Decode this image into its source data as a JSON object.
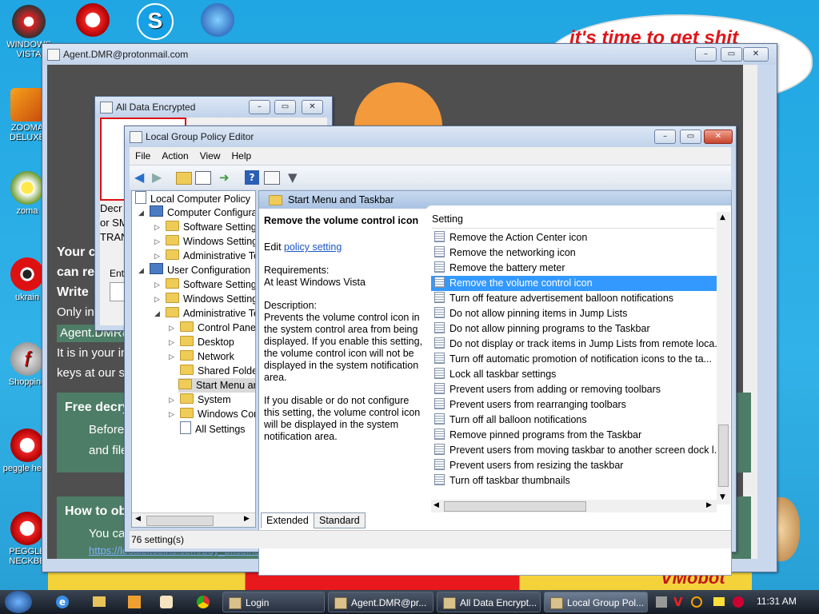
{
  "desktop": {
    "icons": [
      {
        "label": "WINDOWS VISTA",
        "icon": "vista-icon"
      },
      {
        "label": "ZOOMA DELUXE",
        "icon": "zooma-icon"
      },
      {
        "label": "zoma",
        "icon": "flower-icon"
      },
      {
        "label": "ukrain",
        "icon": "radiation-icon"
      },
      {
        "label": "Shopping",
        "icon": "flash-icon"
      },
      {
        "label": "peggle hegg",
        "icon": "peggle-icon"
      },
      {
        "label": "PEGGLE NECKBE",
        "icon": "peggle-icon"
      }
    ],
    "bubble_text": "it's time to get shit",
    "vmobot": "VMobot"
  },
  "ransom_window": {
    "title": "Agent.DMR@protonmail.com",
    "lines": {
      "your_line": "Your c",
      "can_line": "can re",
      "write_line": "Write",
      "only_line": "Only in",
      "agent_line": "Agent.DMR@",
      "it_line": "It is in your in",
      "keys_line": "keys at our s",
      "free_title": "Free decry",
      "before_line": "Before",
      "and_line": "and file",
      "how_title": "How to obt",
      "you_line": "You ca",
      "link": "https://localbitcoins.com/buy_bitcoins"
    }
  },
  "encrypted_window": {
    "title": "All Data Encrypted",
    "lines": {
      "l1": "Decr",
      "l2": "or SM",
      "l3": "TRAN",
      "enter": "Ente"
    }
  },
  "gpedit": {
    "title": "Local Group Policy Editor",
    "menu": [
      "File",
      "Action",
      "View",
      "Help"
    ],
    "toolbar_icons": [
      "back-arrow-icon",
      "forward-arrow-icon",
      "up-folder-icon",
      "show-hide-tree-icon",
      "export-list-icon",
      "help-icon",
      "properties-icon",
      "filter-icon"
    ],
    "tree": {
      "root": "Local Computer Policy",
      "computer_config": "Computer Configura",
      "cc_software": "Software Settings",
      "cc_windows": "Windows Setting",
      "cc_admin": "Administrative Te",
      "user_config": "User Configuration",
      "uc_software": "Software Settings",
      "uc_windows": "Windows Settings",
      "uc_admin": "Administrative Te",
      "control_panel": "Control Panel",
      "desktop": "Desktop",
      "network": "Network",
      "shared_folders": "Shared Folder",
      "start_menu": "Start Menu ar",
      "system": "System",
      "windows_comp": "Windows Cor",
      "all_settings": "All Settings"
    },
    "header": "Start Menu and Taskbar",
    "detail": {
      "title": "Remove the volume control icon",
      "edit_prefix": "Edit",
      "edit_link": "policy setting",
      "req_label": "Requirements:",
      "req_value": "At least Windows Vista",
      "desc_label": "Description:",
      "desc_p1": "Prevents the volume control icon in the system control area from being displayed. If you enable this setting, the volume control icon will not be displayed in the system notification area.",
      "desc_p2": "If you disable or do not configure this setting, the volume control icon will be displayed in the system notification area."
    },
    "column_header": "Setting",
    "settings": [
      "Remove the Action Center icon",
      "Remove the networking icon",
      "Remove the battery meter",
      "Remove the volume control icon",
      "Turn off feature advertisement balloon notifications",
      "Do not allow pinning items in Jump Lists",
      "Do not allow pinning programs to the Taskbar",
      "Do not display or track items in Jump Lists from remote loca...",
      "Turn off automatic promotion of notification icons to the ta...",
      "Lock all taskbar settings",
      "Prevent users from adding or removing toolbars",
      "Prevent users from rearranging toolbars",
      "Turn off all balloon notifications",
      "Remove pinned programs from the Taskbar",
      "Prevent users from moving taskbar to another screen dock l...",
      "Prevent users from resizing the taskbar",
      "Turn off taskbar thumbnails"
    ],
    "selected_index": 3,
    "tabs": [
      "Extended",
      "Standard"
    ],
    "status": "76 setting(s)"
  },
  "taskbar": {
    "items": [
      {
        "label": "Login"
      },
      {
        "label": "Agent.DMR@pr..."
      },
      {
        "label": "All Data Encrypt..."
      },
      {
        "label": "Local Group Pol..."
      }
    ],
    "clock": "11:31 AM"
  },
  "colors": {
    "selection": "#3399ff",
    "ransom_bg": "#4f4f4f",
    "green_box": "#4d7d66"
  }
}
